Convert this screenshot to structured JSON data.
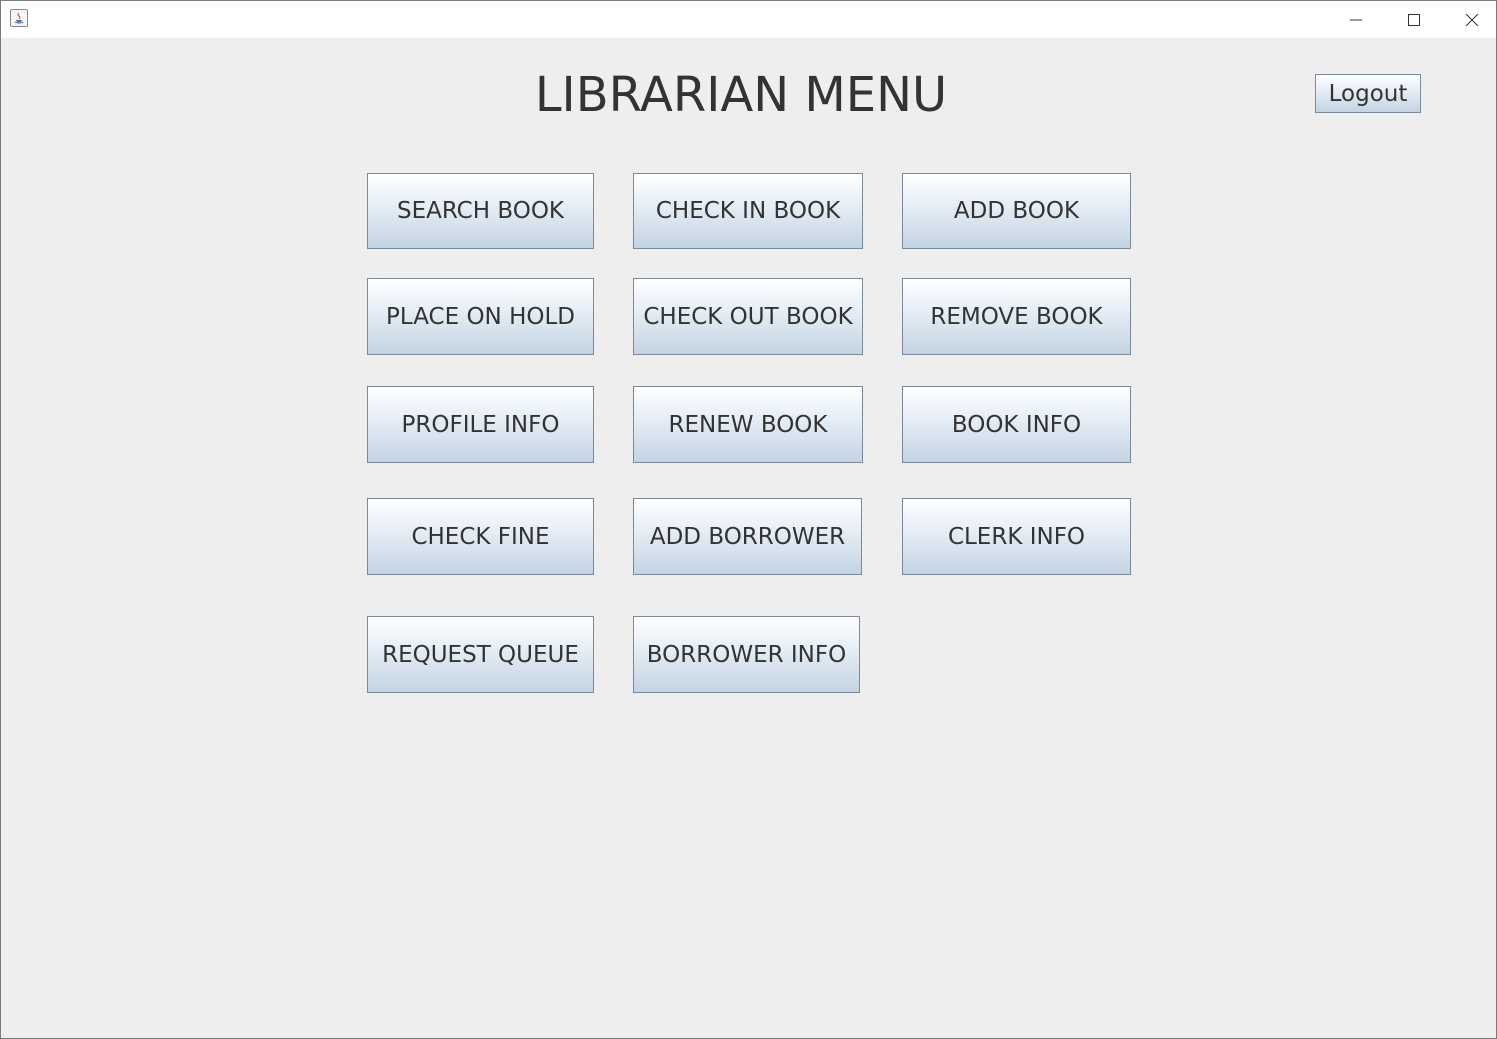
{
  "window": {
    "controls": {
      "minimize_icon": "minimize-icon",
      "maximize_icon": "maximize-icon",
      "close_icon": "close-icon"
    },
    "app_icon": "java-app-icon"
  },
  "header": {
    "title": "LIBRARIAN MENU",
    "logout_label": "Logout"
  },
  "menu": {
    "search_book": "SEARCH BOOK",
    "check_in_book": "CHECK IN BOOK",
    "add_book": "ADD BOOK",
    "place_on_hold": "PLACE ON HOLD",
    "check_out_book": "CHECK OUT BOOK",
    "remove_book": "REMOVE BOOK",
    "profile_info": "PROFILE INFO",
    "renew_book": "RENEW BOOK",
    "book_info": "BOOK INFO",
    "check_fine": "CHECK FINE",
    "add_borrower": "ADD BORROWER",
    "clerk_info": "CLERK INFO",
    "request_queue": "REQUEST QUEUE",
    "borrower_info": "BORROWER INFO"
  },
  "colors": {
    "background": "#eeeeee",
    "button_gradient_top": "#ffffff",
    "button_gradient_bottom": "#c3d3e3",
    "button_border": "#7a8a99",
    "text": "#333333"
  }
}
